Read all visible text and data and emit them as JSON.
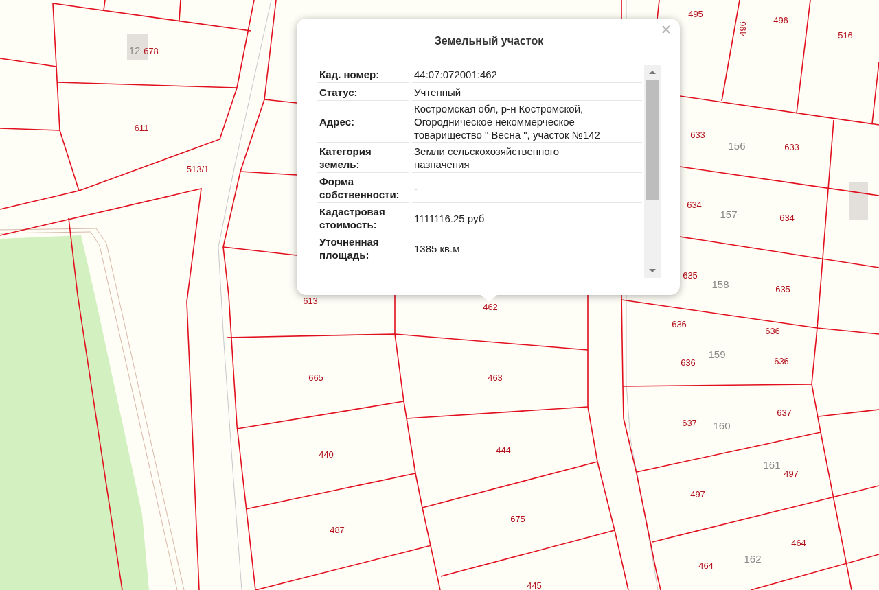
{
  "map": {
    "labels": [
      {
        "text": "495",
        "kind": "lot"
      },
      {
        "text": "496",
        "kind": "lot"
      },
      {
        "text": "496",
        "kind": "lot"
      },
      {
        "text": "516",
        "kind": "lot"
      },
      {
        "text": "12",
        "kind": "block"
      },
      {
        "text": "678",
        "kind": "lot"
      },
      {
        "text": "611",
        "kind": "lot"
      },
      {
        "text": "513/1",
        "kind": "lot"
      },
      {
        "text": "633",
        "kind": "lot"
      },
      {
        "text": "156",
        "kind": "block"
      },
      {
        "text": "633",
        "kind": "lot"
      },
      {
        "text": "634",
        "kind": "lot"
      },
      {
        "text": "157",
        "kind": "block"
      },
      {
        "text": "634",
        "kind": "lot"
      },
      {
        "text": "635",
        "kind": "lot"
      },
      {
        "text": "158",
        "kind": "block"
      },
      {
        "text": "635",
        "kind": "lot"
      },
      {
        "text": "613",
        "kind": "lot"
      },
      {
        "text": "462",
        "kind": "lot"
      },
      {
        "text": "636",
        "kind": "lot"
      },
      {
        "text": "636",
        "kind": "lot"
      },
      {
        "text": "636",
        "kind": "lot"
      },
      {
        "text": "159",
        "kind": "block"
      },
      {
        "text": "636",
        "kind": "lot"
      },
      {
        "text": "665",
        "kind": "lot"
      },
      {
        "text": "463",
        "kind": "lot"
      },
      {
        "text": "637",
        "kind": "lot"
      },
      {
        "text": "160",
        "kind": "block"
      },
      {
        "text": "637",
        "kind": "lot"
      },
      {
        "text": "440",
        "kind": "lot"
      },
      {
        "text": "444",
        "kind": "lot"
      },
      {
        "text": "161",
        "kind": "block"
      },
      {
        "text": "497",
        "kind": "lot"
      },
      {
        "text": "497",
        "kind": "lot"
      },
      {
        "text": "487",
        "kind": "lot"
      },
      {
        "text": "675",
        "kind": "lot"
      },
      {
        "text": "464",
        "kind": "lot"
      },
      {
        "text": "162",
        "kind": "block"
      },
      {
        "text": "464",
        "kind": "lot"
      },
      {
        "text": "445",
        "kind": "lot"
      }
    ]
  },
  "popup": {
    "title": "Земельный участок",
    "rows": [
      {
        "label": "Кад. номер:",
        "value": "44:07:072001:462"
      },
      {
        "label": "Статус:",
        "value": "Учтенный"
      },
      {
        "label": "Адрес:",
        "value": "Костромская обл, р-н Костромской, Огородническое некоммерческое товарищество \" Весна \", участок №142"
      },
      {
        "label": "Категория земель:",
        "value": "Земли сельскохозяйственного назначения"
      },
      {
        "label": "Форма собственности:",
        "value": "-"
      },
      {
        "label": "Кадастровая стоимость:",
        "value": "1111116.25 руб"
      },
      {
        "label": "Уточненная площадь:",
        "value": "1385 кв.м"
      }
    ]
  }
}
